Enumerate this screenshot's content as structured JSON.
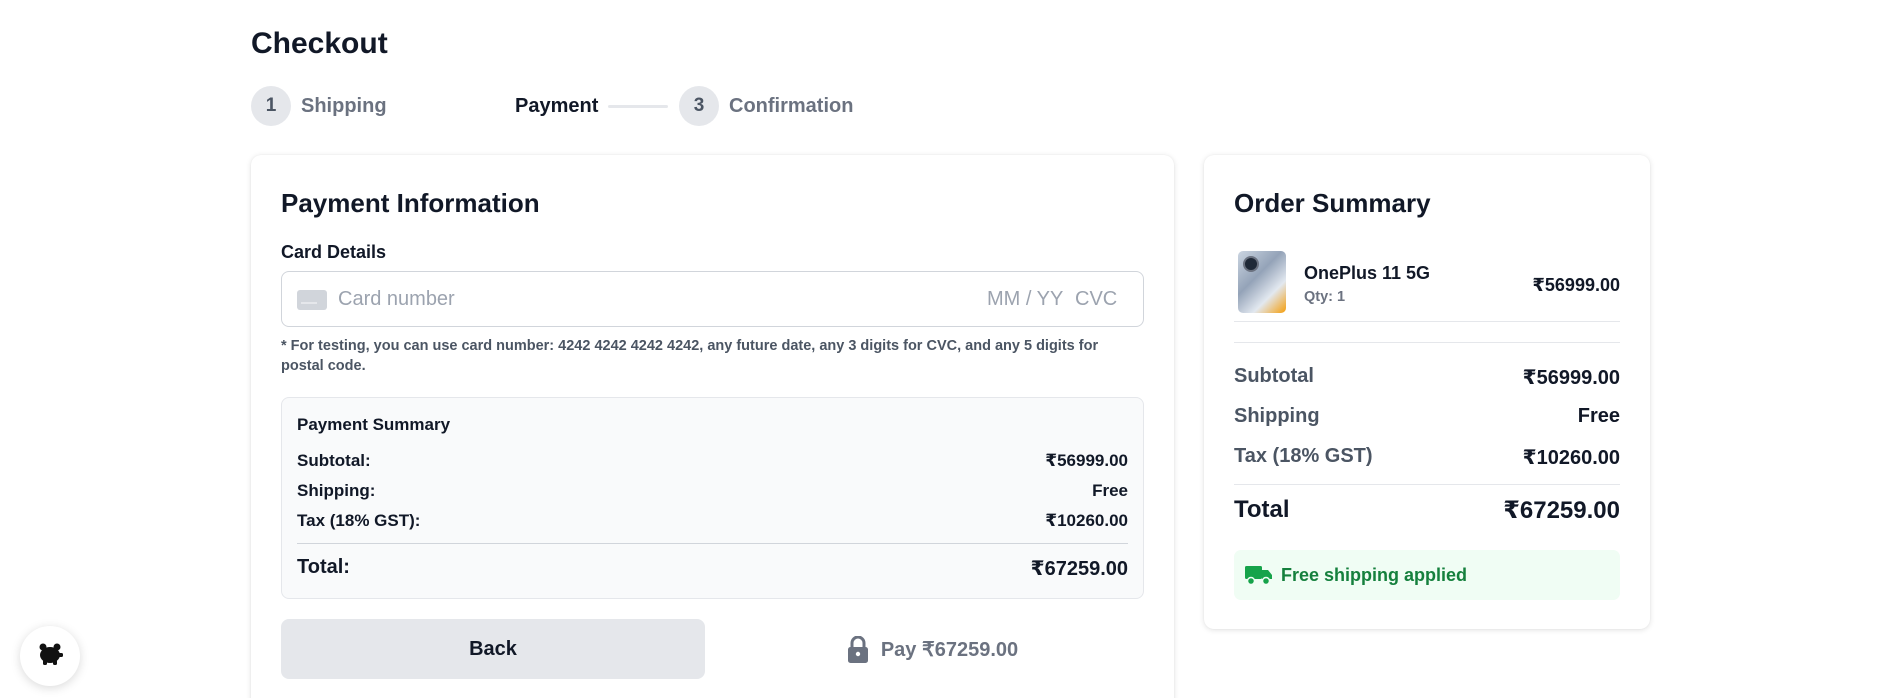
{
  "page": {
    "title": "Checkout"
  },
  "steps": [
    {
      "number": "1",
      "label": "Shipping",
      "state": "done"
    },
    {
      "number": "",
      "label": "Payment",
      "state": "active"
    },
    {
      "number": "3",
      "label": "Confirmation",
      "state": "upcoming"
    }
  ],
  "payment": {
    "heading": "Payment Information",
    "card_details_label": "Card Details",
    "card_number_placeholder": "Card number",
    "expiry_placeholder": "MM / YY",
    "cvc_placeholder": "CVC",
    "test_note": "* For testing, you can use card number: 4242 4242 4242 4242, any future date, any 3 digits for CVC, and any 5 digits for postal code.",
    "summary": {
      "title": "Payment Summary",
      "subtotal_label": "Subtotal:",
      "subtotal_value": "₹56999.00",
      "shipping_label": "Shipping:",
      "shipping_value": "Free",
      "tax_label": "Tax (18% GST):",
      "tax_value": "₹10260.00",
      "total_label": "Total:",
      "total_value": "₹67259.00"
    },
    "back_label": "Back",
    "pay_label": "Pay ₹67259.00"
  },
  "order_summary": {
    "heading": "Order Summary",
    "item": {
      "name": "OnePlus 11 5G",
      "qty": "Qty: 1",
      "price": "₹56999.00"
    },
    "subtotal_label": "Subtotal",
    "subtotal_value": "₹56999.00",
    "shipping_label": "Shipping",
    "shipping_value": "Free",
    "tax_label": "Tax (18% GST)",
    "tax_value": "₹10260.00",
    "total_label": "Total",
    "total_value": "₹67259.00",
    "free_shipping_text": "Free shipping applied"
  },
  "colors": {
    "accent_green": "#15803d",
    "muted_gray": "#6b7280",
    "button_gray": "#e5e7eb"
  },
  "icons": {
    "card": "credit-card-icon",
    "lock": "lock-icon",
    "truck": "truck-icon",
    "fab": "piggy-bank-icon"
  }
}
